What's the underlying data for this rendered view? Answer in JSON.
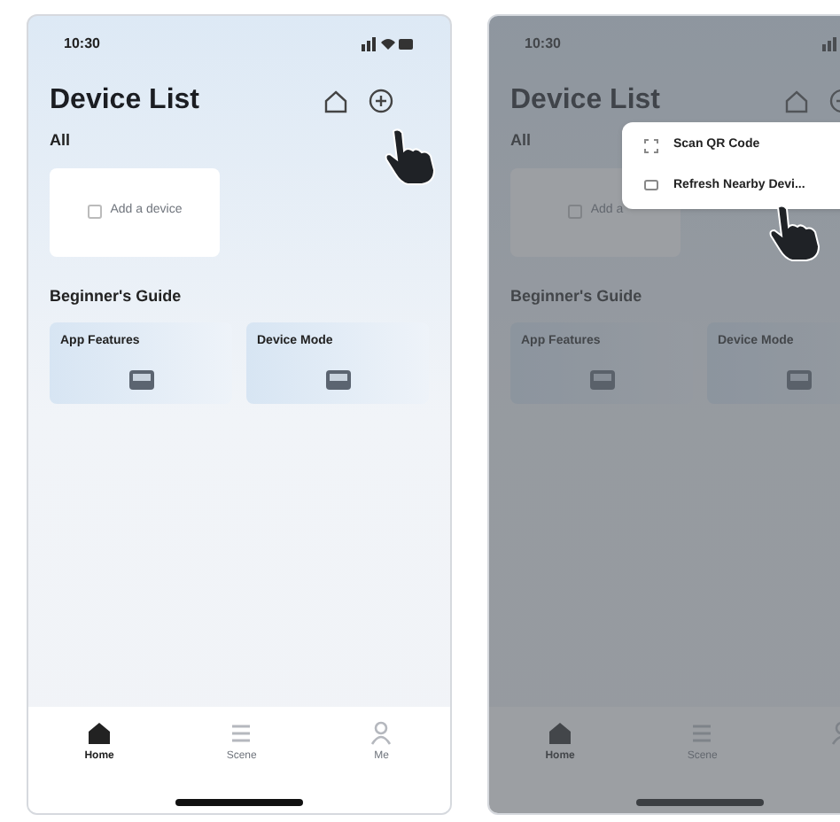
{
  "screens": [
    {
      "dimmed": false,
      "status_time": "10:30",
      "title": "Device List",
      "filter": "All",
      "add_device": "Add a device",
      "guide_title": "Beginner's Guide",
      "guides": [
        {
          "title": "App Features"
        },
        {
          "title": "Device Mode"
        }
      ],
      "tabs": [
        {
          "label": "Home",
          "selected": true
        },
        {
          "label": "Scene",
          "selected": false
        },
        {
          "label": "Me",
          "selected": false
        }
      ]
    },
    {
      "dimmed": true,
      "status_time": "10:30",
      "title": "Device List",
      "filter": "All",
      "add_device": "Add a",
      "guide_title": "Beginner's Guide",
      "guides": [
        {
          "title": "App Features"
        },
        {
          "title": "Device Mode"
        }
      ],
      "tabs": [
        {
          "label": "Home",
          "selected": true
        },
        {
          "label": "Scene",
          "selected": false
        },
        {
          "selected": false
        }
      ],
      "menu": [
        {
          "kind": "scan",
          "label": "Scan QR Code"
        },
        {
          "kind": "refresh",
          "label": "Refresh Nearby Devi..."
        }
      ]
    }
  ]
}
